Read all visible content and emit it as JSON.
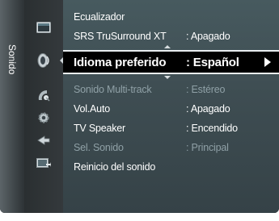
{
  "sidebar": {
    "label": "Sonido"
  },
  "icons": [
    {
      "name": "picture-icon"
    },
    {
      "name": "sound-icon",
      "active": true
    },
    {
      "name": "channel-icon"
    },
    {
      "name": "setup-icon"
    },
    {
      "name": "input-icon"
    },
    {
      "name": "application-icon"
    }
  ],
  "menu": {
    "items": [
      {
        "label": "Ecualizador",
        "value": ""
      },
      {
        "label": "SRS TruSurround XT",
        "value": ": Apagado"
      },
      {
        "label": "Idioma preferido",
        "value": ": Español",
        "selected": true
      },
      {
        "label": "Sonido Multi-track",
        "value": ": Estéreo",
        "disabled": true
      },
      {
        "label": "Vol.Auto",
        "value": ": Apagado"
      },
      {
        "label": "TV Speaker",
        "value": ": Encendido"
      },
      {
        "label": "Sel. Sonido",
        "value": ": Principal",
        "disabled": true
      },
      {
        "label": "Reinicio del sonido",
        "value": ""
      }
    ]
  },
  "colors": {
    "menu_bg": "#3f4e53",
    "selected_bg": "#000000",
    "text": "#ffffff",
    "disabled_text": "#8fa0a6"
  }
}
